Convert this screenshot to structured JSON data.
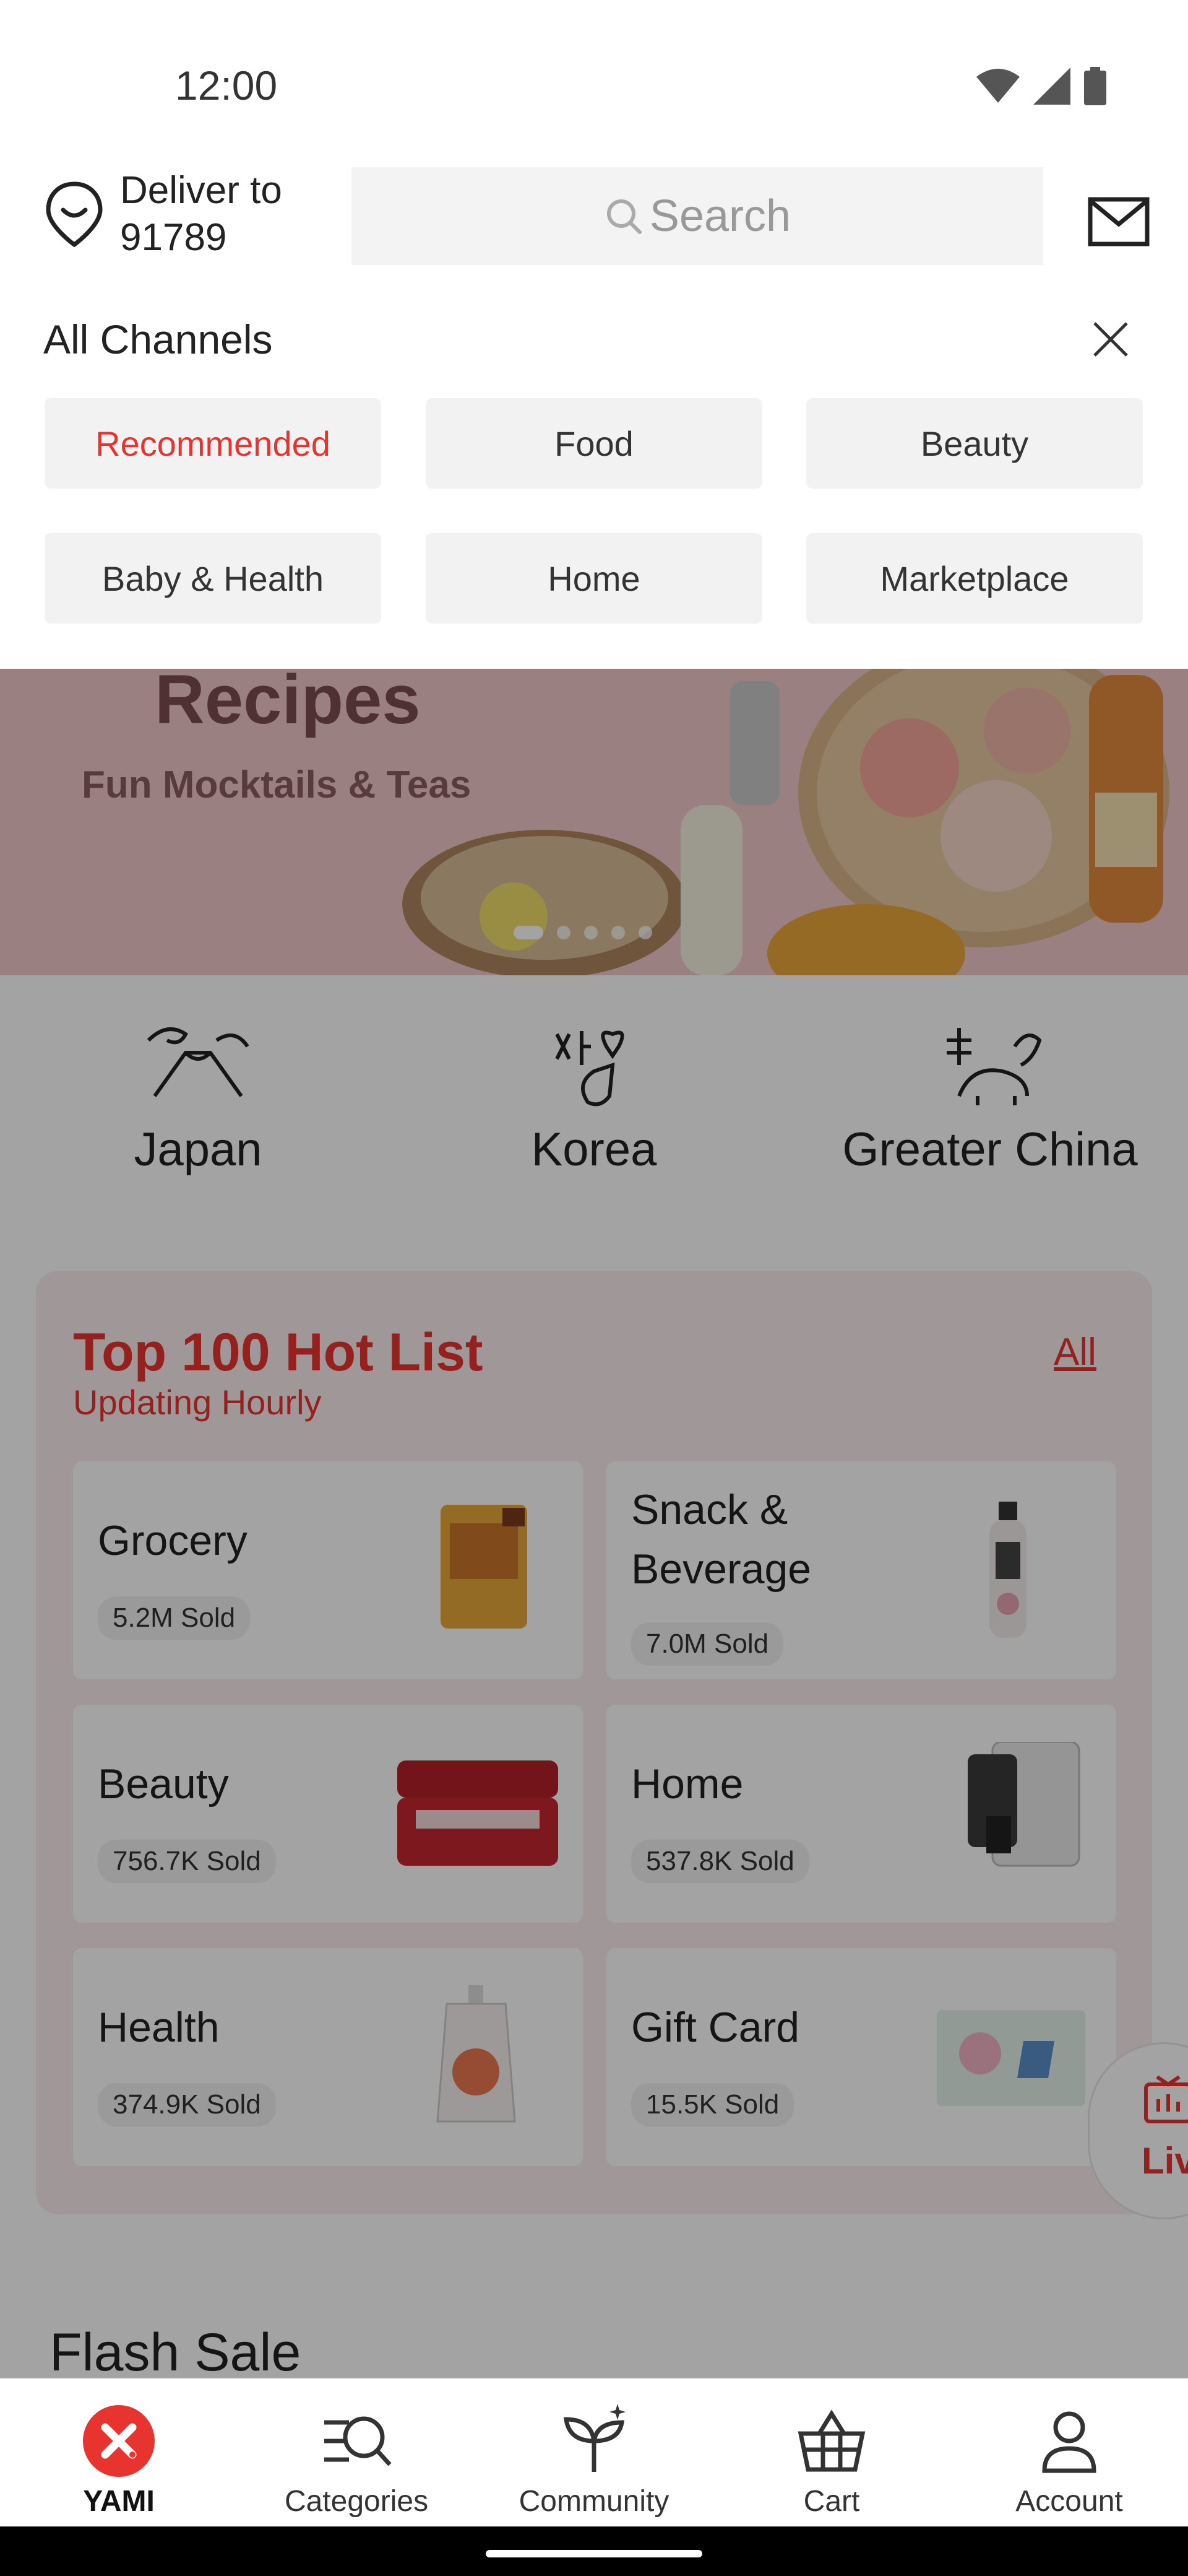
{
  "status": {
    "time": "12:00"
  },
  "header": {
    "deliver_label": "Deliver to",
    "zip": "91789",
    "search_placeholder": "Search"
  },
  "channels": {
    "title": "All Channels",
    "items": [
      {
        "label": "Recommended",
        "active": true
      },
      {
        "label": "Food",
        "active": false
      },
      {
        "label": "Beauty",
        "active": false
      },
      {
        "label": "Baby & Health",
        "active": false
      },
      {
        "label": "Home",
        "active": false
      },
      {
        "label": "Marketplace",
        "active": false
      }
    ]
  },
  "banner": {
    "title": "Recipes",
    "subtitle": "Fun Mocktails & Teas"
  },
  "countries": [
    {
      "label": "Japan",
      "icon": "mount-fuji-icon"
    },
    {
      "label": "Korea",
      "icon": "korean-heart-icon"
    },
    {
      "label": "Greater China",
      "icon": "ox-icon"
    }
  ],
  "hot_list": {
    "title": "Top 100 Hot List",
    "subtitle": "Updating Hourly",
    "all_link": "All",
    "tiles": [
      {
        "name": "Grocery",
        "sold": "5.2M Sold"
      },
      {
        "name": "Snack & Beverage",
        "sold": "7.0M Sold"
      },
      {
        "name": "Beauty",
        "sold": "756.7K Sold"
      },
      {
        "name": "Home",
        "sold": "537.8K Sold"
      },
      {
        "name": "Health",
        "sold": "374.9K Sold"
      },
      {
        "name": "Gift Card",
        "sold": "15.5K Sold"
      }
    ]
  },
  "flash_sale": {
    "title": "Flash Sale"
  },
  "live": {
    "label": "Liv"
  },
  "nav": {
    "items": [
      {
        "label": "YAMI"
      },
      {
        "label": "Categories"
      },
      {
        "label": "Community"
      },
      {
        "label": "Cart"
      },
      {
        "label": "Account"
      }
    ]
  },
  "colors": {
    "accent": "#e8342e",
    "chip_bg": "#f2f2f2",
    "overlay": "rgba(0,0,0,0.36)"
  }
}
